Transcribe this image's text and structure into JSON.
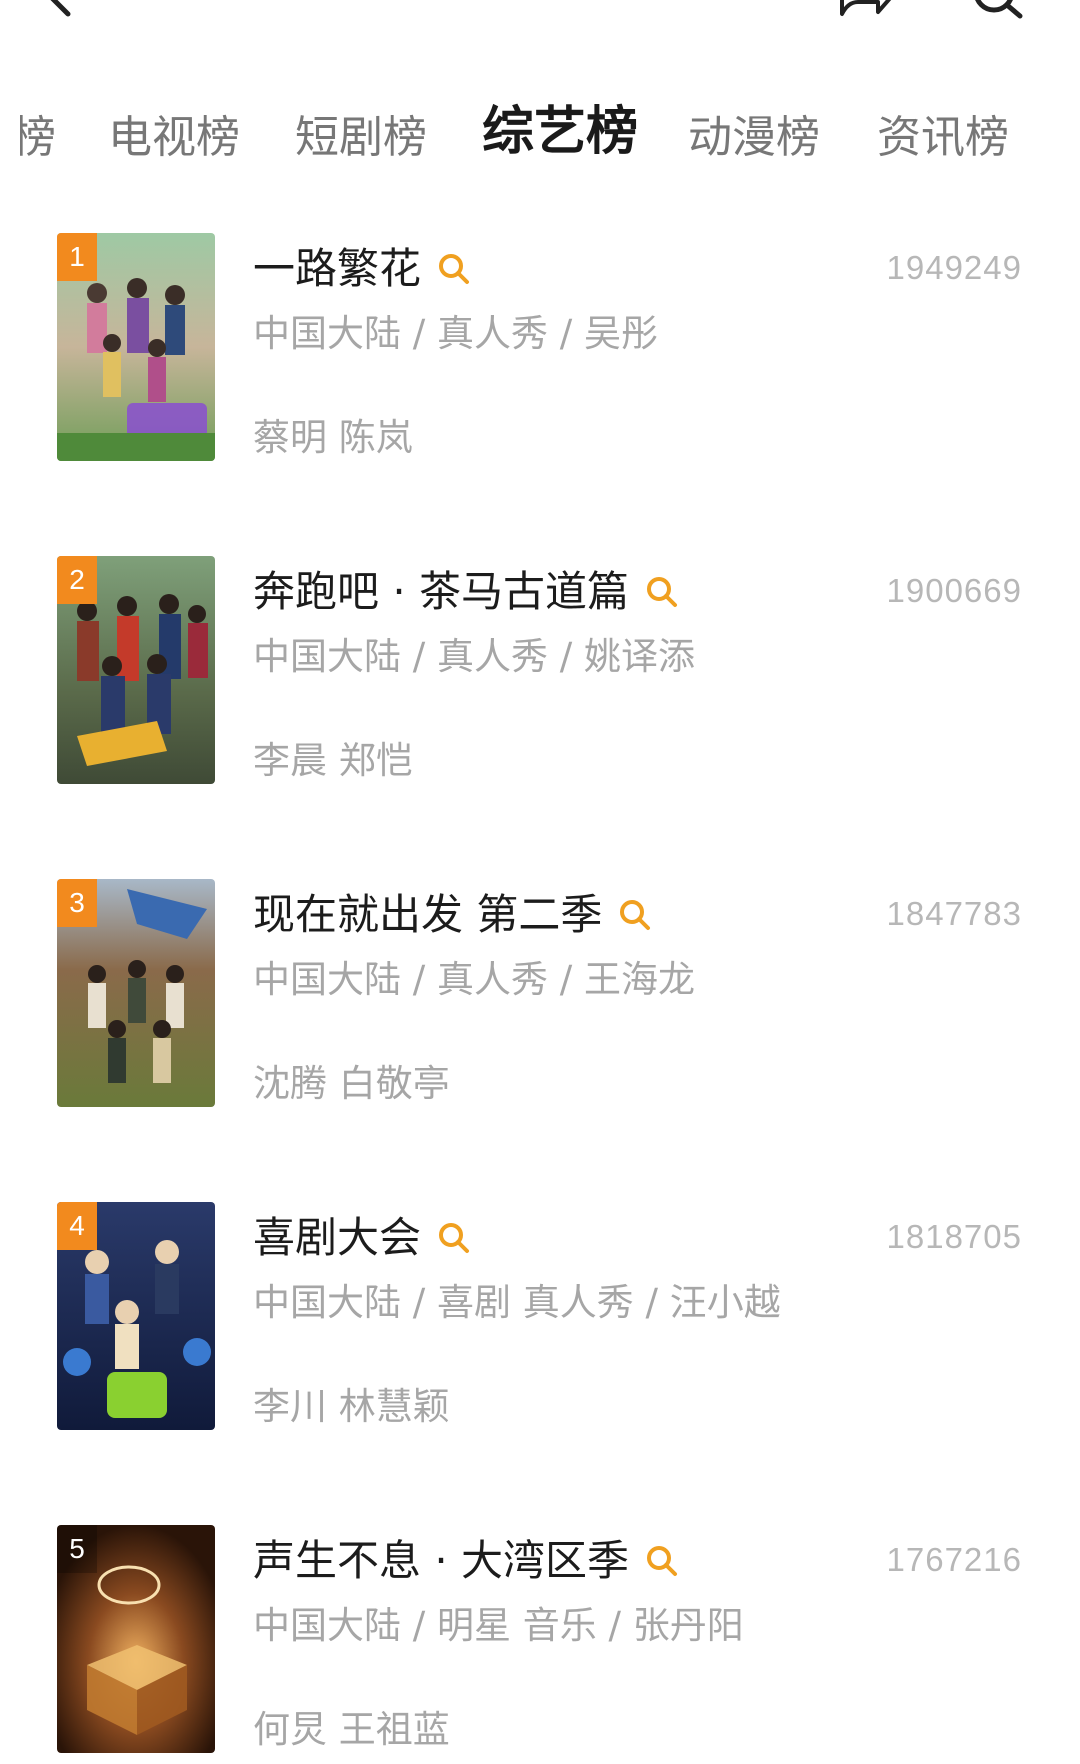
{
  "header": {
    "back_icon": "back-arrow-icon",
    "share_icon": "share-icon",
    "search_icon": "search-icon"
  },
  "tabs": [
    {
      "label": "榜"
    },
    {
      "label": "电视榜"
    },
    {
      "label": "短剧榜"
    },
    {
      "label": "综艺榜",
      "active": true
    },
    {
      "label": "动漫榜"
    },
    {
      "label": "资讯榜"
    }
  ],
  "list": [
    {
      "rank": "1",
      "title": "一路繁花",
      "score": "1949249",
      "meta": "中国大陆 / 真人秀 / 吴彤",
      "cast": "蔡明 陈岚"
    },
    {
      "rank": "2",
      "title": "奔跑吧 · 茶马古道篇",
      "score": "1900669",
      "meta": "中国大陆 / 真人秀 / 姚译添",
      "cast": "李晨 郑恺"
    },
    {
      "rank": "3",
      "title": "现在就出发 第二季",
      "score": "1847783",
      "meta": "中国大陆 / 真人秀 / 王海龙",
      "cast": "沈腾 白敬亭"
    },
    {
      "rank": "4",
      "title": "喜剧大会",
      "score": "1818705",
      "meta": "中国大陆 / 喜剧 真人秀 / 汪小越",
      "cast": "李川 林慧颖"
    },
    {
      "rank": "5",
      "title": "声生不息 · 大湾区季",
      "score": "1767216",
      "meta": "中国大陆 / 明星 音乐 / 张丹阳",
      "cast": "何炅 王祖蓝"
    }
  ],
  "colors": {
    "rank_badge": "#f28a1e",
    "search_accent": "#f0a020",
    "score": "#b7b7b7",
    "meta": "#a6a6a6"
  }
}
